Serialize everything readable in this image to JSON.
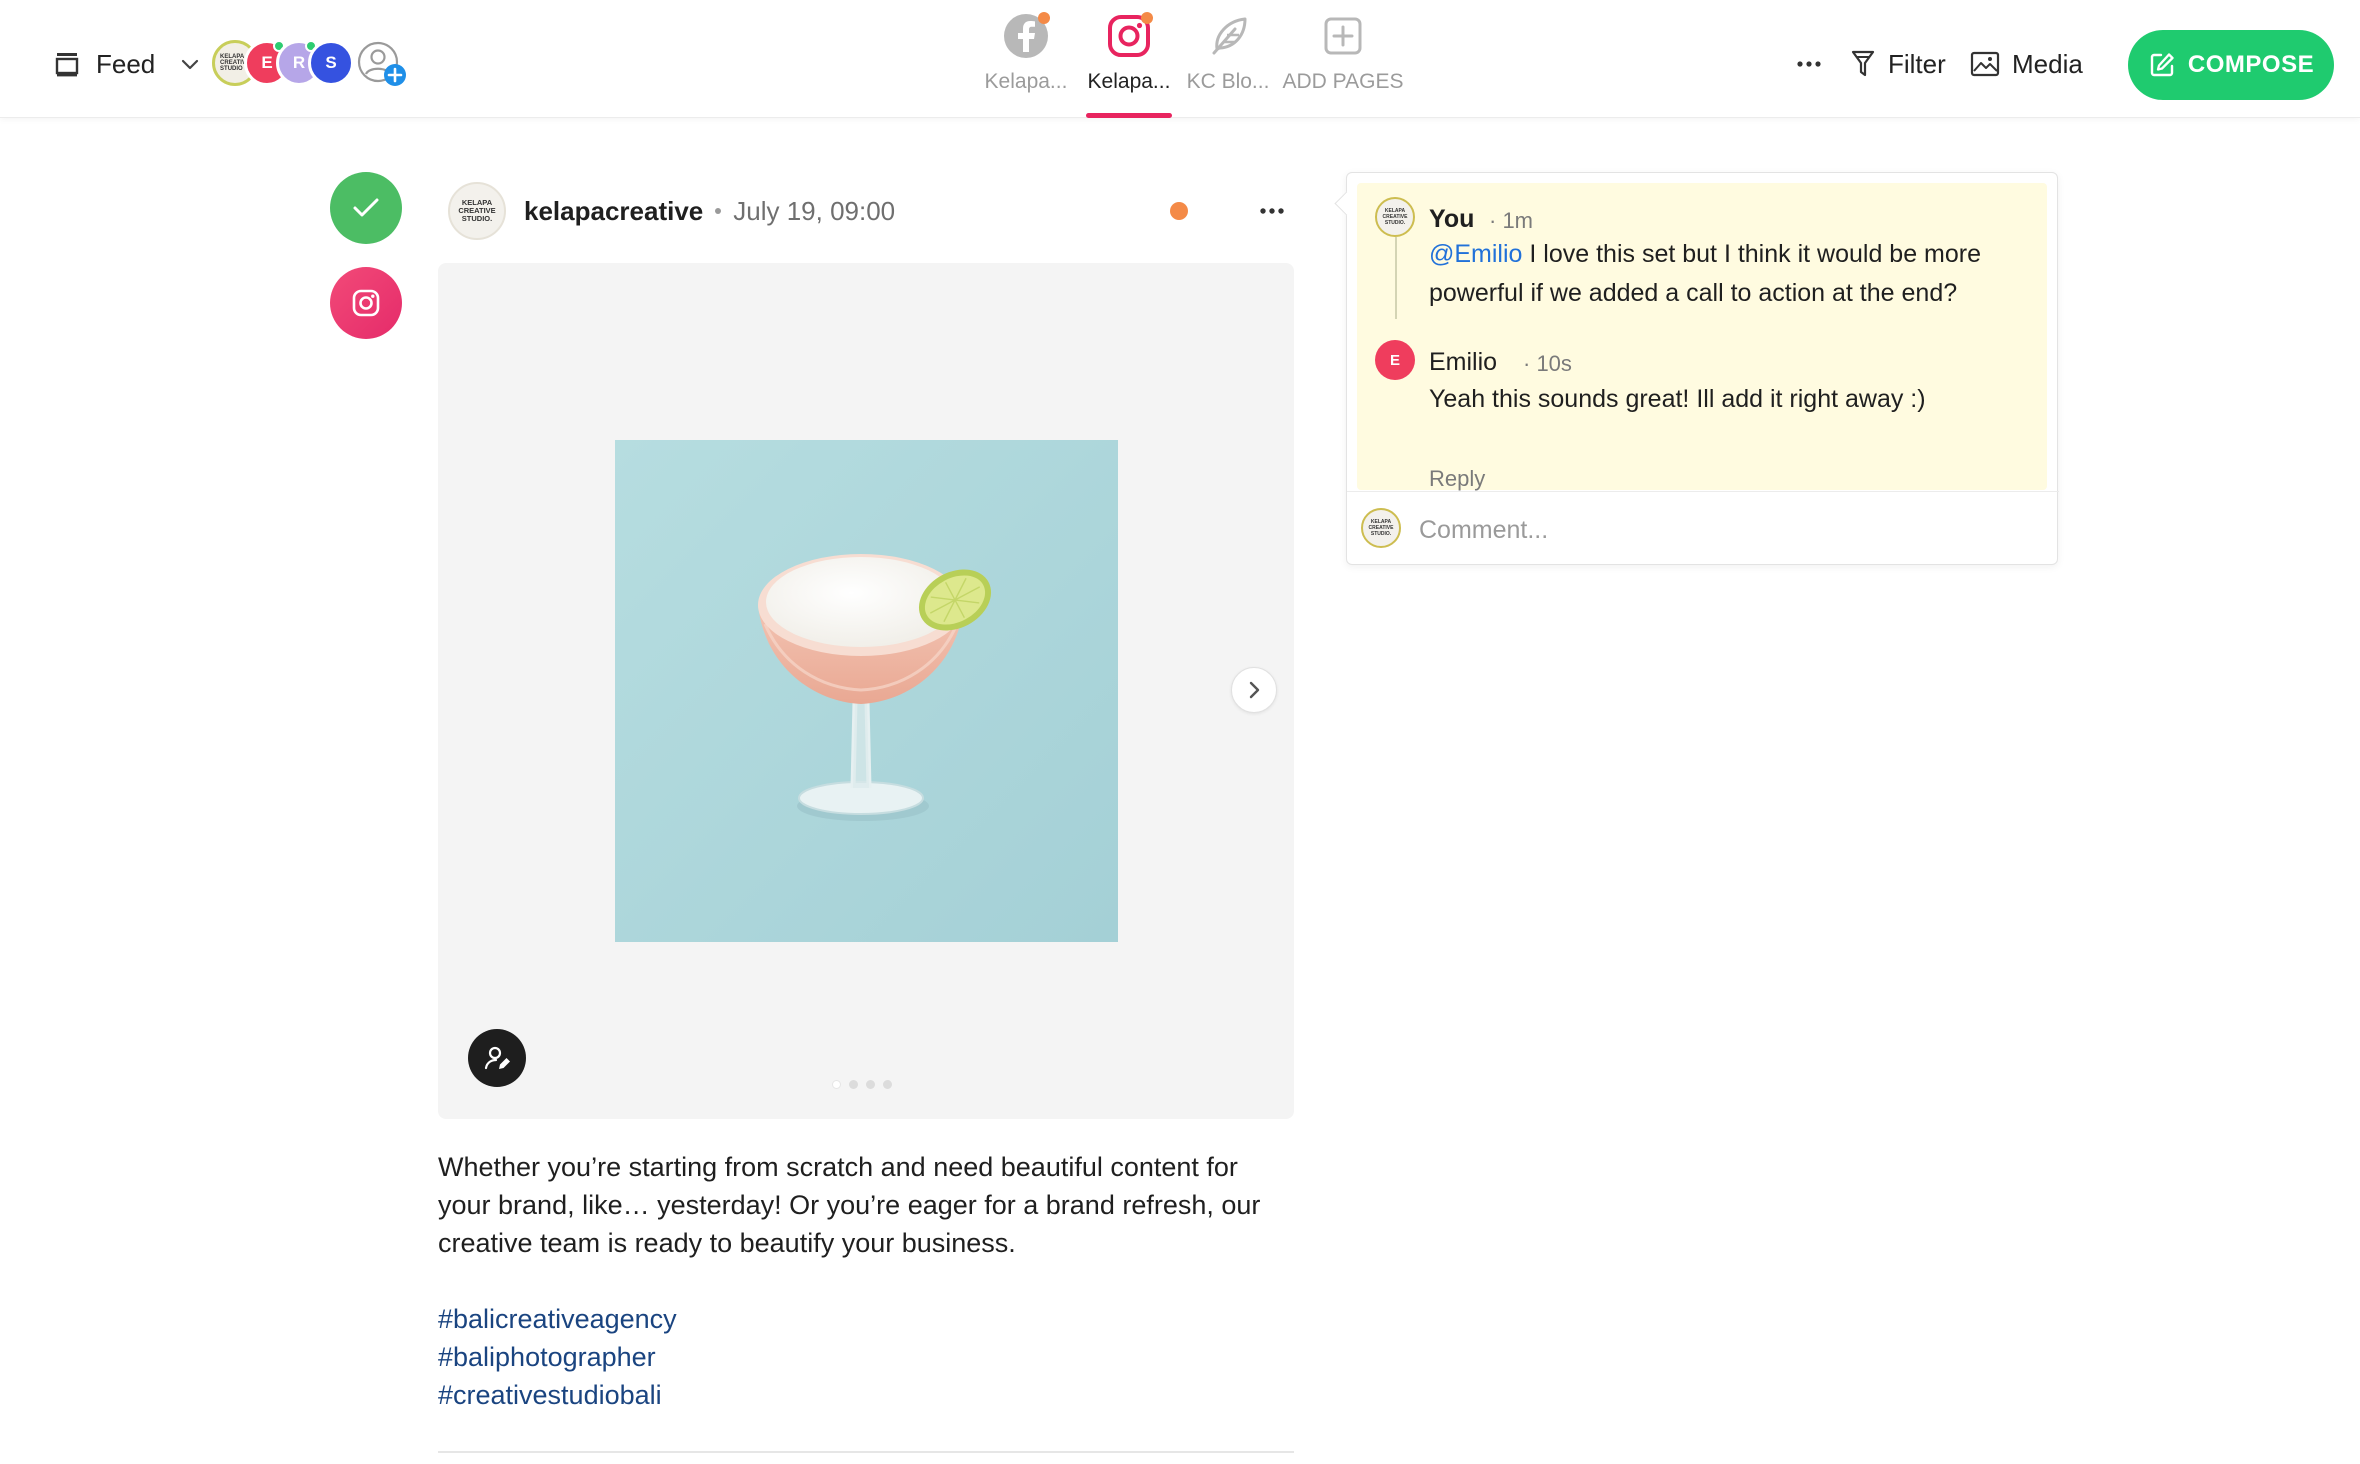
{
  "topbar": {
    "feed_label": "Feed",
    "team_avatars": [
      {
        "initial": "KELAPA CREATIVE STUDIO",
        "color": "#f2efe6",
        "online": false,
        "kind": "logo"
      },
      {
        "initial": "E",
        "color": "#ef3d5d",
        "online": true,
        "kind": "letter"
      },
      {
        "initial": "R",
        "color": "#b6a6e8",
        "online": true,
        "kind": "letter"
      },
      {
        "initial": "S",
        "color": "#3552e0",
        "online": false,
        "kind": "letter"
      }
    ],
    "pages": [
      {
        "label": "Kelapa...",
        "network": "facebook",
        "icon": "facebook-icon",
        "notification": true,
        "active": false
      },
      {
        "label": "Kelapa...",
        "network": "instagram",
        "icon": "instagram-icon",
        "notification": true,
        "active": true
      },
      {
        "label": "KC Blo...",
        "network": "blog",
        "icon": "feather-icon",
        "notification": false,
        "active": false
      },
      {
        "label": "ADD PAGES",
        "network": "add",
        "icon": "plus-square-icon",
        "notification": false,
        "active": false
      }
    ],
    "more_label": "···",
    "filter_label": "Filter",
    "media_label": "Media",
    "compose_label": "COMPOSE"
  },
  "post": {
    "account_logo_lines": [
      "KELAPA",
      "CREATIVE",
      "STUDIO."
    ],
    "account_name": "kelapacreative",
    "datetime": "July 19, 09:00",
    "status": "approved",
    "network": "instagram",
    "carousel": {
      "count": 4,
      "current": 1
    },
    "caption": "Whether you’re starting from scratch and need beautiful content for your brand, like… yesterday! Or you’re eager for a brand refresh, our creative team is ready to beautify your business.",
    "hashtags": [
      "#balicreativeagency",
      "#baliphotographer",
      "#creativestudiobali"
    ]
  },
  "comments": {
    "thread": [
      {
        "author": "You",
        "time": "· 1m",
        "mention": "@Emilio",
        "text": " I love this set but I think it would be more powerful if we added a call to action at the end?",
        "avatar_kind": "logo"
      },
      {
        "author": "Emilio",
        "time": "· 10s",
        "text": "Yeah this sounds great! Ill add it right away :)",
        "avatar_initial": "E",
        "avatar_kind": "letter"
      }
    ],
    "reply_label": "Reply",
    "input_placeholder": "Comment..."
  },
  "colors": {
    "compose_green": "#1fcb6f",
    "instagram_pink": "#e8245f",
    "notification_orange": "#f48a47",
    "approved_green": "#4cbd64",
    "comment_highlight": "#fffbe0",
    "mention_blue": "#2171d9",
    "hashtag_navy": "#1a4480"
  }
}
